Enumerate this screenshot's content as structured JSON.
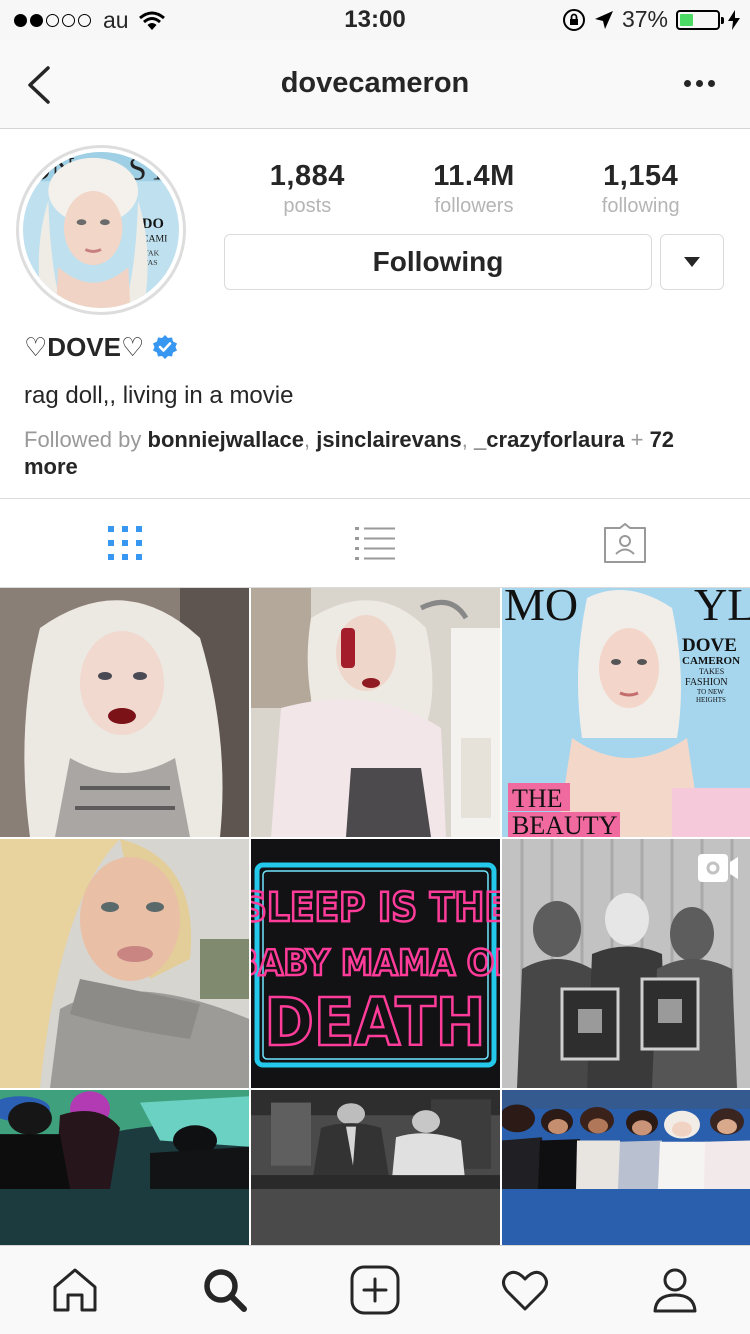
{
  "status_bar": {
    "carrier": "au",
    "time": "13:00",
    "battery": "37%",
    "battery_level": 0.37,
    "battery_color": "#4cd964"
  },
  "nav": {
    "title": "dovecameron",
    "back_icon": "chevron-left-icon",
    "more_icon": "more-horizontal-icon"
  },
  "profile": {
    "stats": [
      {
        "value": "1,884",
        "label": "posts"
      },
      {
        "value": "11.4M",
        "label": "followers"
      },
      {
        "value": "1,154",
        "label": "following"
      }
    ],
    "follow_button": "Following",
    "name": "♡DOVE♡",
    "verified_color": "#3897f0",
    "bio": "rag doll,, living in a movie",
    "followed_by": {
      "prefix": "Followed by",
      "users": [
        "bonniejwallace",
        "jsinclairevans",
        "_crazyforlaura"
      ],
      "suffix": "+ 72",
      "more": "more"
    }
  },
  "tabs": [
    {
      "name": "grid-icon",
      "active": true,
      "color": "#3897f0"
    },
    {
      "name": "list-icon",
      "active": false
    },
    {
      "name": "tagged-icon",
      "active": false
    }
  ],
  "posts": [
    {
      "alt": "portrait-red-lips"
    },
    {
      "alt": "pink-fur-phone"
    },
    {
      "alt": "magazine-cover",
      "cover_text": [
        "DOVE",
        "CAMERON",
        "TAKES",
        "FASHION",
        "TO NEW",
        "HEIGHTS"
      ],
      "banner": [
        "THE",
        "BEAUTY"
      ]
    },
    {
      "alt": "selfie-blonde"
    },
    {
      "alt": "neon-sign",
      "neon": [
        "SLEEP IS THE",
        "BABY MAMA OF",
        "DEATH"
      ]
    },
    {
      "alt": "video-award-plaques",
      "badge": "video-icon"
    },
    {
      "alt": "concert-stage"
    },
    {
      "alt": "black-white-film"
    },
    {
      "alt": "group-photo"
    }
  ],
  "bottom_tabs": [
    "home-icon",
    "search-icon",
    "add-icon",
    "heart-icon",
    "profile-icon"
  ]
}
